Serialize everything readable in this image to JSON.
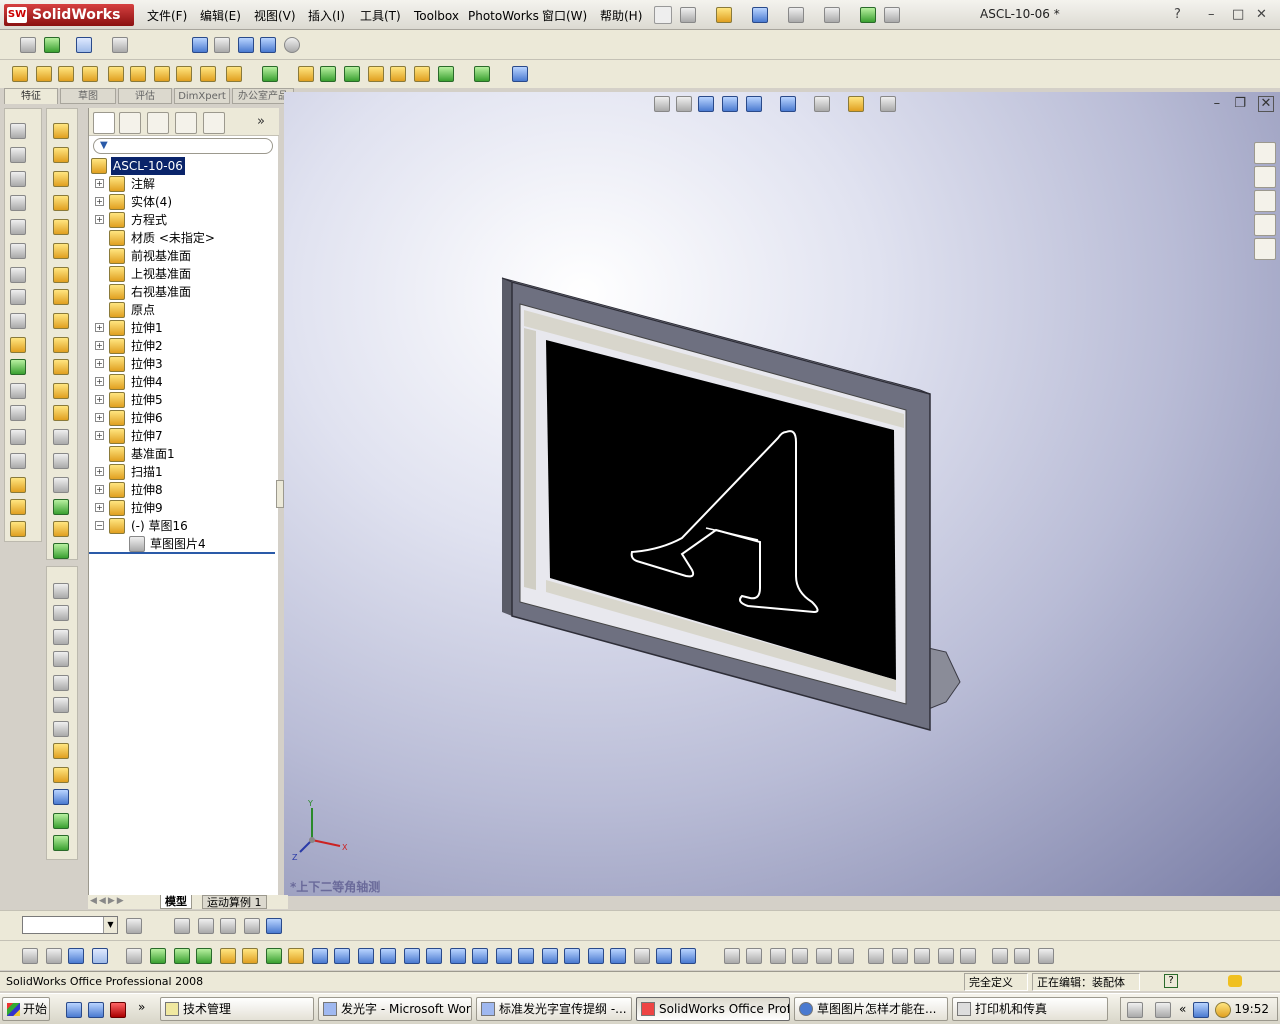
{
  "app": {
    "logo_text": "SolidWorks",
    "logo_mark": "SW",
    "doc_title": "ASCL-10-06 *",
    "help_glyph": "?"
  },
  "menu": [
    "文件(F)",
    "编辑(E)",
    "视图(V)",
    "插入(I)",
    "工具(T)",
    "Toolbox",
    "PhotoWorks",
    "窗口(W)",
    "帮助(H)"
  ],
  "command_tabs": [
    "特征",
    "草图",
    "评估",
    "DimXpert",
    "办公室产品"
  ],
  "tree": {
    "root": "ASCL-10-06",
    "items": [
      {
        "label": "注解",
        "expand": "+",
        "icon": "annotation-icon"
      },
      {
        "label": "实体(4)",
        "expand": "+",
        "icon": "solid-bodies-icon"
      },
      {
        "label": "方程式",
        "expand": "+",
        "icon": "equations-icon"
      },
      {
        "label": "材质 <未指定>",
        "expand": "",
        "icon": "material-icon"
      },
      {
        "label": "前视基准面",
        "expand": "",
        "icon": "plane-icon"
      },
      {
        "label": "上视基准面",
        "expand": "",
        "icon": "plane-icon"
      },
      {
        "label": "右视基准面",
        "expand": "",
        "icon": "plane-icon"
      },
      {
        "label": "原点",
        "expand": "",
        "icon": "origin-icon"
      },
      {
        "label": "拉伸1",
        "expand": "+",
        "icon": "extrude-icon"
      },
      {
        "label": "拉伸2",
        "expand": "+",
        "icon": "extrude-icon"
      },
      {
        "label": "拉伸3",
        "expand": "+",
        "icon": "extrude-icon"
      },
      {
        "label": "拉伸4",
        "expand": "+",
        "icon": "extrude-icon"
      },
      {
        "label": "拉伸5",
        "expand": "+",
        "icon": "extrude-icon"
      },
      {
        "label": "拉伸6",
        "expand": "+",
        "icon": "extrude-icon"
      },
      {
        "label": "拉伸7",
        "expand": "+",
        "icon": "extrude-icon"
      },
      {
        "label": "基准面1",
        "expand": "",
        "icon": "plane-icon"
      },
      {
        "label": "扫描1",
        "expand": "+",
        "icon": "sweep-icon"
      },
      {
        "label": "拉伸8",
        "expand": "+",
        "icon": "extrude-icon"
      },
      {
        "label": "拉伸9",
        "expand": "+",
        "icon": "extrude-icon"
      },
      {
        "label": "(-) 草图16",
        "expand": "−",
        "icon": "sketch-icon"
      }
    ],
    "child": {
      "label": "草图图片4",
      "icon": "sketch-picture-icon"
    }
  },
  "viewport": {
    "view_name": "*上下二等角轴测",
    "axis_labels": {
      "x": "X",
      "y": "Y",
      "z": "Z"
    }
  },
  "model_tabs": [
    "模型",
    "运动算例 1"
  ],
  "status": {
    "product": "SolidWorks Office Professional 2008",
    "definition": "完全定义",
    "editing": "正在编辑：装配体"
  },
  "taskbar": {
    "start": "开始",
    "tasks": [
      "技术管理",
      "发光字 - Microsoft Word",
      "标准发光字宣传提纲 -...",
      "SolidWorks Office Profe...",
      "草图图片怎样才能在...",
      "打印机和传真"
    ],
    "active_index": 3,
    "clock": "19:52"
  },
  "colors": {
    "selection": "#0a246a",
    "screen": "#000000",
    "monitor_frame": "#6e7080"
  }
}
